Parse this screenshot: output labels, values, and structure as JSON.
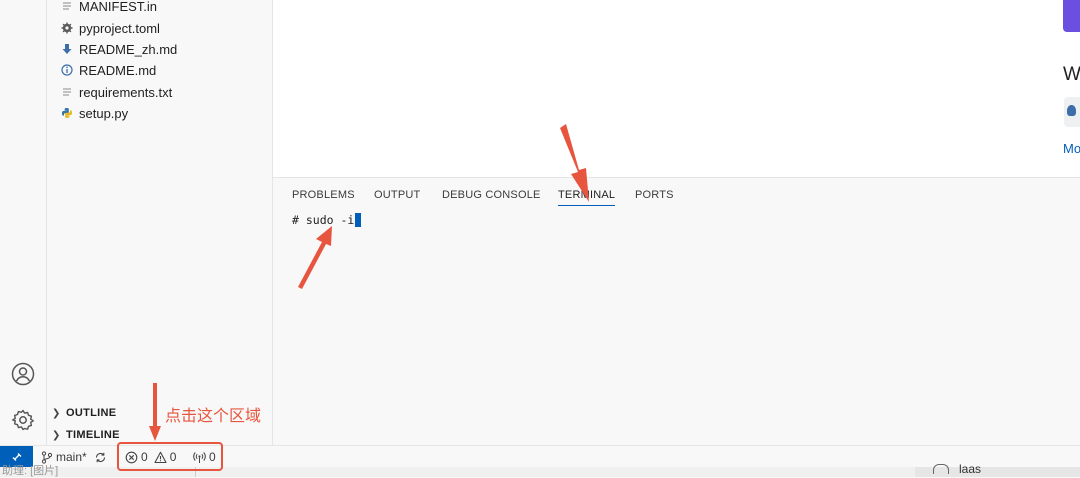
{
  "explorer": {
    "files": [
      {
        "name": "MANIFEST.in",
        "icon": "lines-icon"
      },
      {
        "name": "pyproject.toml",
        "icon": "gear-icon"
      },
      {
        "name": "README_zh.md",
        "icon": "markdown-icon"
      },
      {
        "name": "README.md",
        "icon": "info-icon"
      },
      {
        "name": "requirements.txt",
        "icon": "lines-icon"
      },
      {
        "name": "setup.py",
        "icon": "python-icon"
      }
    ],
    "sections": {
      "outline": "OUTLINE",
      "timeline": "TIMELINE"
    }
  },
  "editor": {
    "side_text_1": "W",
    "side_text_2": "Mo",
    "accent": "#6b4fe0"
  },
  "panel": {
    "tabs": [
      "PROBLEMS",
      "OUTPUT",
      "DEBUG CONSOLE",
      "TERMINAL",
      "PORTS"
    ],
    "active_tab": "TERMINAL",
    "terminal_text": "# sudo -i"
  },
  "status_bar": {
    "branch": "main*",
    "errors": "0",
    "warnings": "0",
    "ports": "0",
    "accent": "#005fb8"
  },
  "bottom_strip": {
    "left_text": "助理: [图片]",
    "right_text": "laas"
  },
  "annotation": {
    "text": "点击这个区域",
    "color": "#e8553e"
  }
}
